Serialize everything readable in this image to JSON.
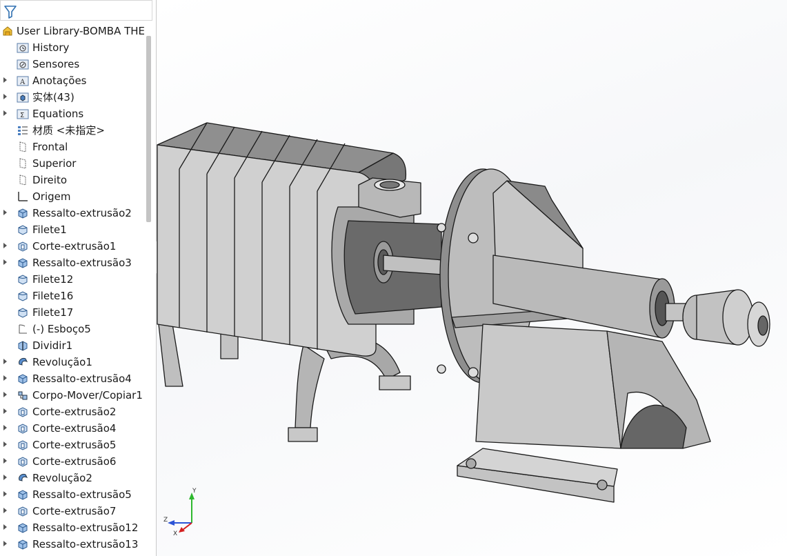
{
  "feature_tree": {
    "root": {
      "label": "User Library-BOMBA THE",
      "icon": "part-icon"
    },
    "items": [
      {
        "label": "History",
        "icon": "history-folder-icon",
        "expandable": false
      },
      {
        "label": "Sensores",
        "icon": "sensor-folder-icon",
        "expandable": false
      },
      {
        "label": "Anotações",
        "icon": "annotations-folder-icon",
        "expandable": true
      },
      {
        "label": "实体(43)",
        "icon": "solid-bodies-folder-icon",
        "expandable": true
      },
      {
        "label": "Equations",
        "icon": "equations-folder-icon",
        "expandable": true
      },
      {
        "label": "材质 <未指定>",
        "icon": "material-icon",
        "expandable": false
      },
      {
        "label": "Frontal",
        "icon": "plane-icon",
        "expandable": false
      },
      {
        "label": "Superior",
        "icon": "plane-icon",
        "expandable": false
      },
      {
        "label": "Direito",
        "icon": "plane-icon",
        "expandable": false
      },
      {
        "label": "Origem",
        "icon": "origin-icon",
        "expandable": false
      },
      {
        "label": "Ressalto-extrusão2",
        "icon": "boss-extrude-icon",
        "expandable": true
      },
      {
        "label": "Filete1",
        "icon": "fillet-icon",
        "expandable": false
      },
      {
        "label": "Corte-extrusão1",
        "icon": "cut-extrude-icon",
        "expandable": true
      },
      {
        "label": "Ressalto-extrusão3",
        "icon": "boss-extrude-icon",
        "expandable": true
      },
      {
        "label": "Filete12",
        "icon": "fillet-icon",
        "expandable": false
      },
      {
        "label": "Filete16",
        "icon": "fillet-icon",
        "expandable": false
      },
      {
        "label": "Filete17",
        "icon": "fillet-icon",
        "expandable": false
      },
      {
        "label": "(-) Esboço5",
        "icon": "sketch-icon",
        "expandable": false
      },
      {
        "label": "Dividir1",
        "icon": "split-icon",
        "expandable": false
      },
      {
        "label": "Revolução1",
        "icon": "revolve-icon",
        "expandable": true
      },
      {
        "label": "Ressalto-extrusão4",
        "icon": "boss-extrude-icon",
        "expandable": true
      },
      {
        "label": "Corpo-Mover/Copiar1",
        "icon": "move-copy-body-icon",
        "expandable": true
      },
      {
        "label": "Corte-extrusão2",
        "icon": "cut-extrude-icon",
        "expandable": true
      },
      {
        "label": "Corte-extrusão4",
        "icon": "cut-extrude-icon",
        "expandable": true
      },
      {
        "label": "Corte-extrusão5",
        "icon": "cut-extrude-icon",
        "expandable": true
      },
      {
        "label": "Corte-extrusão6",
        "icon": "cut-extrude-icon",
        "expandable": true
      },
      {
        "label": "Revolução2",
        "icon": "revolve-icon",
        "expandable": true
      },
      {
        "label": "Ressalto-extrusão5",
        "icon": "boss-extrude-icon",
        "expandable": true
      },
      {
        "label": "Corte-extrusão7",
        "icon": "cut-extrude-icon",
        "expandable": true
      },
      {
        "label": "Ressalto-extrusão12",
        "icon": "boss-extrude-icon",
        "expandable": true
      },
      {
        "label": "Ressalto-extrusão13",
        "icon": "boss-extrude-icon",
        "expandable": true
      }
    ]
  },
  "triad": {
    "y_label": "Y",
    "z_label": "Z",
    "x_label": "X"
  },
  "colors": {
    "model_face": "#c8c8c8",
    "model_dark": "#5a5a5a",
    "axis_x": "#d42020",
    "axis_y": "#2eb82e",
    "axis_z": "#2b53d6"
  }
}
